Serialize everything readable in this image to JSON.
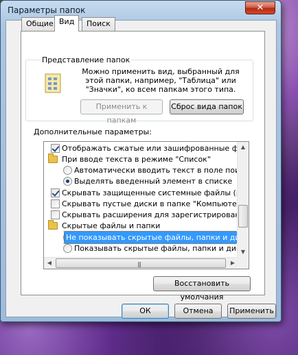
{
  "window": {
    "title": "Параметры папок",
    "close_label": "✕"
  },
  "tabs": [
    {
      "label": "Общие"
    },
    {
      "label": "Вид"
    },
    {
      "label": "Поиск"
    }
  ],
  "folder_views": {
    "legend": "Представление папок",
    "description": "Можно применить вид, выбранный для этой папки, например, \"Таблица\" или \"Значки\", ко всем папкам этого типа.",
    "apply_label": "Применить к папкам",
    "reset_label": "Сброс вида папок"
  },
  "advanced": {
    "label": "Дополнительные параметры:",
    "items": [
      {
        "type": "checkbox",
        "checked": true,
        "label": "Отображать сжатые или зашифрованные файлы NTFS"
      },
      {
        "type": "folder",
        "label": "При вводе текста в режиме \"Список\""
      },
      {
        "type": "radio",
        "checked": false,
        "label": "Автоматически вводить текст в поле поиска"
      },
      {
        "type": "radio",
        "checked": true,
        "label": "Выделять введенный элемент в списке"
      },
      {
        "type": "checkbox",
        "checked": true,
        "label": "Скрывать защищенные системные файлы (рекомендуется)"
      },
      {
        "type": "checkbox",
        "checked": false,
        "label": "Скрывать пустые диски в папке \"Компьютер\""
      },
      {
        "type": "checkbox",
        "checked": false,
        "label": "Скрывать расширения для зарегистрированных типов"
      },
      {
        "type": "folder",
        "label": "Скрытые файлы и папки"
      },
      {
        "type": "radio",
        "checked": true,
        "selected": true,
        "label": "Не показывать скрытые файлы, папки и диски"
      },
      {
        "type": "radio",
        "checked": false,
        "label": "Показывать скрытые файлы, папки и диски"
      }
    ],
    "restore_label": "Восстановить умолчания"
  },
  "footer": {
    "ok_label": "ОК",
    "cancel_label": "Отмена",
    "apply_label": "Применить"
  },
  "icons": {
    "close": "close-icon",
    "folder_view": "folder-view-icon",
    "folder": "folder-icon",
    "scroll_up": "scroll-up-icon",
    "scroll_down": "scroll-down-icon",
    "scroll_left": "scroll-left-icon",
    "scroll_right": "scroll-right-icon"
  },
  "colors": {
    "selection": "#3399ff",
    "close_button": "#c7402a",
    "title_bar": "#aac6e2"
  }
}
